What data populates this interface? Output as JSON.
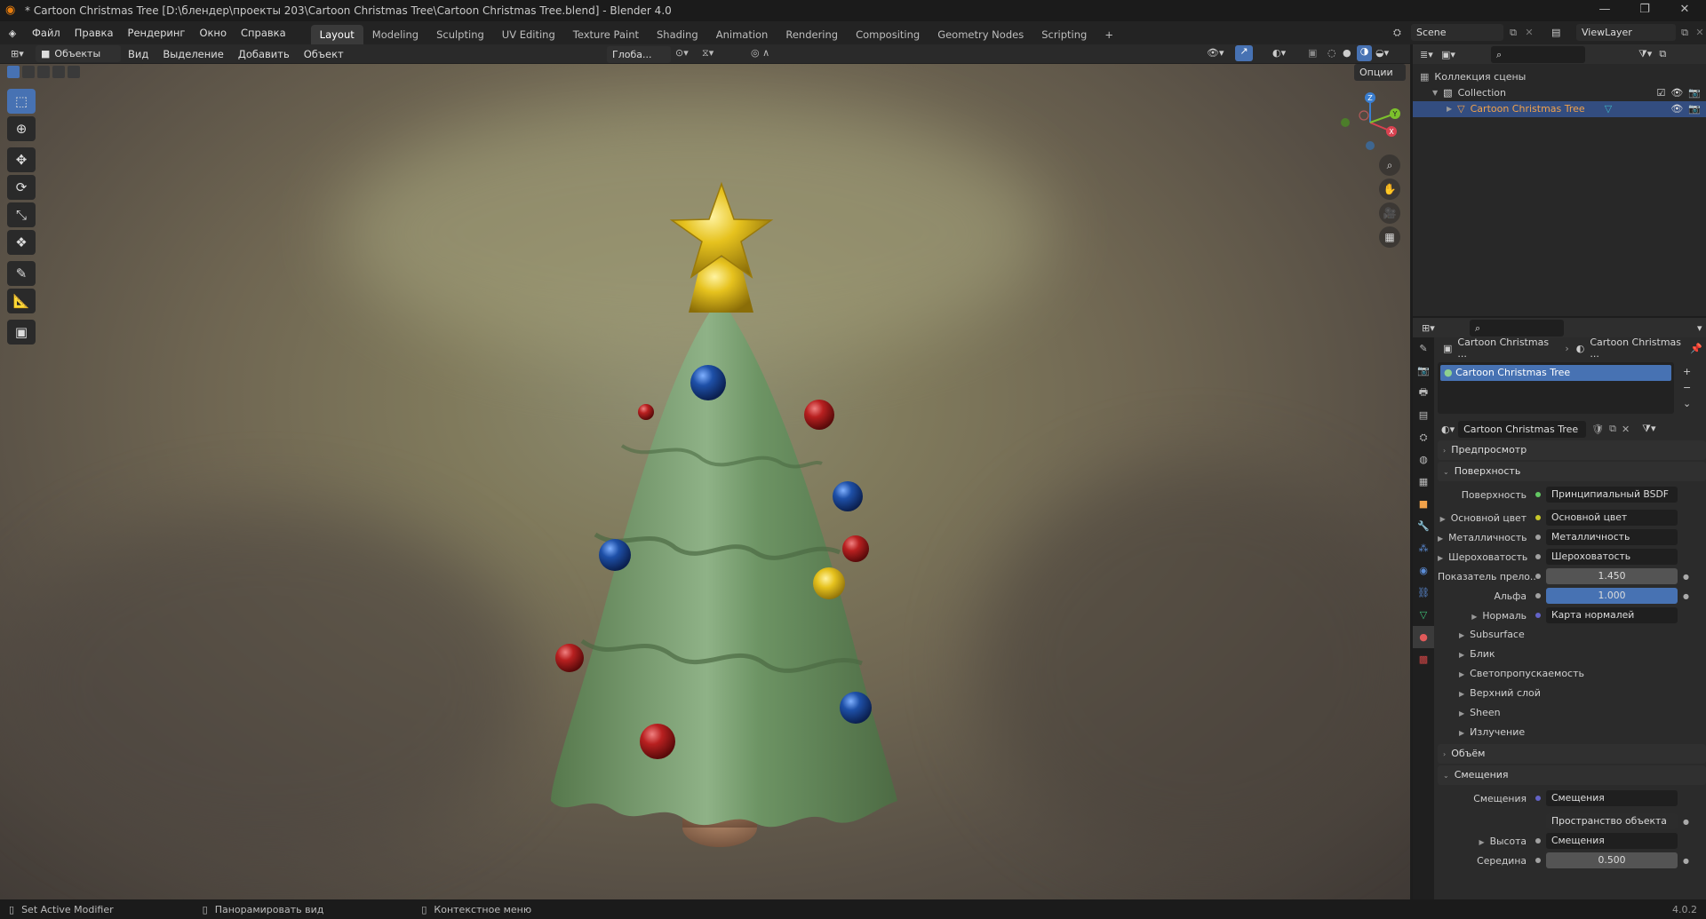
{
  "window": {
    "title": "* Cartoon Christmas Tree [D:\\блендер\\проекты 203\\Cartoon Christmas Tree\\Cartoon Christmas Tree.blend] - Blender 4.0"
  },
  "menu": [
    "Файл",
    "Правка",
    "Рендеринг",
    "Окно",
    "Справка"
  ],
  "workspaces": [
    "Layout",
    "Modeling",
    "Sculpting",
    "UV Editing",
    "Texture Paint",
    "Shading",
    "Animation",
    "Rendering",
    "Compositing",
    "Geometry Nodes",
    "Scripting",
    "+"
  ],
  "scene": {
    "name": "Scene",
    "view_layer": "ViewLayer"
  },
  "viewport_header": {
    "mode": "Объекты",
    "menus": [
      "Вид",
      "Выделение",
      "Добавить",
      "Объект"
    ],
    "orientation": "Глоба...",
    "options": "Опции"
  },
  "gizmo": {
    "x": "X",
    "y": "Y",
    "z": "Z"
  },
  "outliner": {
    "scene_collection": "Коллекция сцены",
    "collection": "Collection",
    "object": "Cartoon Christmas Tree"
  },
  "properties": {
    "breadcrumb": [
      "Cartoon Christmas ...",
      "Cartoon Christmas ..."
    ],
    "slot": "Cartoon Christmas Tree",
    "material": "Cartoon Christmas Tree",
    "sections": {
      "preview": "Предпросмотр",
      "surface": "Поверхность",
      "volume": "Объём",
      "displacement": "Смещения"
    },
    "surface_rows": [
      {
        "label": "Поверхность",
        "value": "Принципиальный BSDF",
        "sock": "#63c763"
      },
      {
        "label": "Основной цвет",
        "value": "Основной цвет",
        "sock": "#c7c729"
      },
      {
        "label": "Металличность",
        "value": "Металличность",
        "sock": "#a1a1a1"
      },
      {
        "label": "Шероховатость",
        "value": "Шероховатость",
        "sock": "#a1a1a1"
      },
      {
        "label": "Показатель прело...",
        "value": "1.450",
        "sock": "#a1a1a1"
      },
      {
        "label": "Альфа",
        "value": "1.000",
        "sock": "#a1a1a1"
      },
      {
        "label": "Нормаль",
        "value": "Карта нормалей",
        "sock": "#6363c7"
      }
    ],
    "subpanels": [
      "Subsurface",
      "Блик",
      "Светопропускаемость",
      "Верхний слой",
      "Sheen",
      "Излучение"
    ],
    "displacement_rows": [
      {
        "label": "Смещения",
        "value": "Смещения",
        "sock": "#6363c7"
      },
      {
        "label": "",
        "value": "Пространство объекта",
        "sock": ""
      },
      {
        "label": "Высота",
        "value": "Смещения",
        "sock": "#a1a1a1"
      },
      {
        "label": "Середина",
        "value": "0.500",
        "sock": "#a1a1a1"
      }
    ]
  },
  "status": {
    "left": "Set Active Modifier",
    "mid": "Панорамировать вид",
    "right": "Контекстное меню",
    "version": "4.0.2"
  },
  "colors": {
    "accent": "#4772b3",
    "selected_text": "#f2a24a"
  }
}
